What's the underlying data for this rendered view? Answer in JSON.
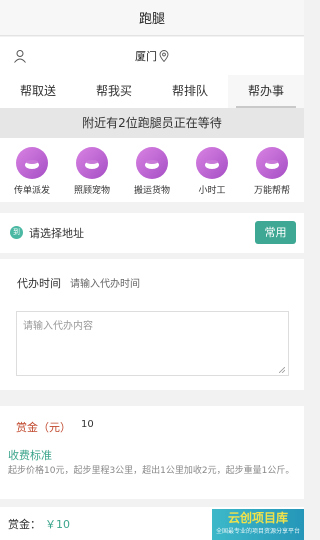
{
  "header": {
    "title": "跑腿"
  },
  "location": {
    "city": "厦门"
  },
  "tabs": [
    {
      "label": "帮取送"
    },
    {
      "label": "帮我买"
    },
    {
      "label": "帮排队"
    },
    {
      "label": "帮办事"
    }
  ],
  "active_tab": "帮办事",
  "notice": "附近有2位跑腿员正在等待",
  "categories": [
    {
      "label": "传单派发",
      "icon": "leaflet-icon"
    },
    {
      "label": "照顾宠物",
      "icon": "pet-icon"
    },
    {
      "label": "搬运货物",
      "icon": "cargo-icon"
    },
    {
      "label": "小时工",
      "icon": "worker-icon"
    },
    {
      "label": "万能帮帮",
      "icon": "helper-icon"
    }
  ],
  "address": {
    "badge": "到",
    "placeholder": "请选择地址",
    "button": "常用"
  },
  "time": {
    "label": "代办时间",
    "placeholder": "请输入代办时间"
  },
  "content": {
    "placeholder": "请输入代办内容"
  },
  "reward": {
    "label": "赏金（元）",
    "value": "10"
  },
  "fee": {
    "title": "收费标准",
    "description": "起步价格10元，起步里程3公里，超出1公里加收2元，起步重量1公斤。"
  },
  "bottom": {
    "label": "赏金：",
    "value": "￥10"
  },
  "watermark": {
    "main": "云创项目库",
    "sub": "全国最专业的项目资源分享平台"
  },
  "colors": {
    "accent": "#3fa894",
    "icon_purple": "#b45fd0",
    "reward_red": "#c24a2f"
  }
}
